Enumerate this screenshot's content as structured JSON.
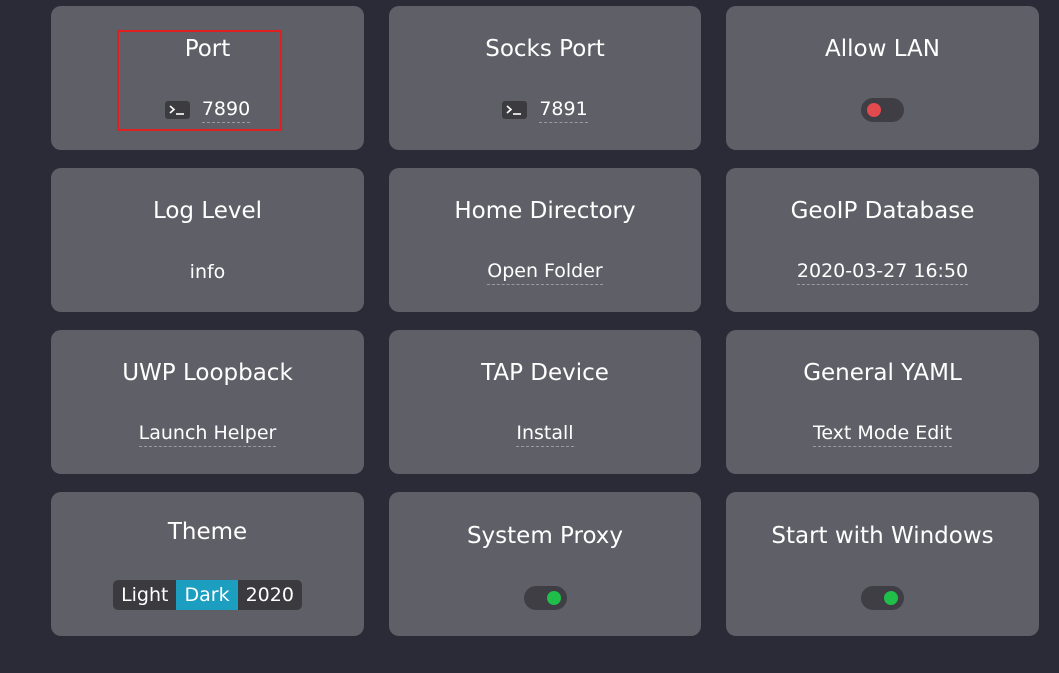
{
  "cards": {
    "port": {
      "title": "Port",
      "value": "7890",
      "icon": "terminal-icon"
    },
    "socks_port": {
      "title": "Socks Port",
      "value": "7891",
      "icon": "terminal-icon"
    },
    "allow_lan": {
      "title": "Allow LAN",
      "state": "off"
    },
    "log_level": {
      "title": "Log Level",
      "value": "info"
    },
    "home_directory": {
      "title": "Home Directory",
      "value": "Open Folder"
    },
    "geoip_database": {
      "title": "GeoIP Database",
      "value": "2020-03-27 16:50"
    },
    "uwp_loopback": {
      "title": "UWP Loopback",
      "value": "Launch Helper"
    },
    "tap_device": {
      "title": "TAP Device",
      "value": "Install"
    },
    "general_yaml": {
      "title": "General YAML",
      "value": "Text Mode Edit"
    },
    "theme": {
      "title": "Theme",
      "options": [
        "Light",
        "Dark",
        "2020"
      ],
      "selected": "Dark"
    },
    "system_proxy": {
      "title": "System Proxy",
      "state": "on"
    },
    "start_with_windows": {
      "title": "Start with Windows",
      "state": "on"
    }
  },
  "colors": {
    "background": "#2b2a37",
    "card": "#5f5f67",
    "accent": "#1c9ec0",
    "toggle_on": "#1fbf4a",
    "toggle_off": "#e24a4e",
    "highlight": "#e02020"
  }
}
